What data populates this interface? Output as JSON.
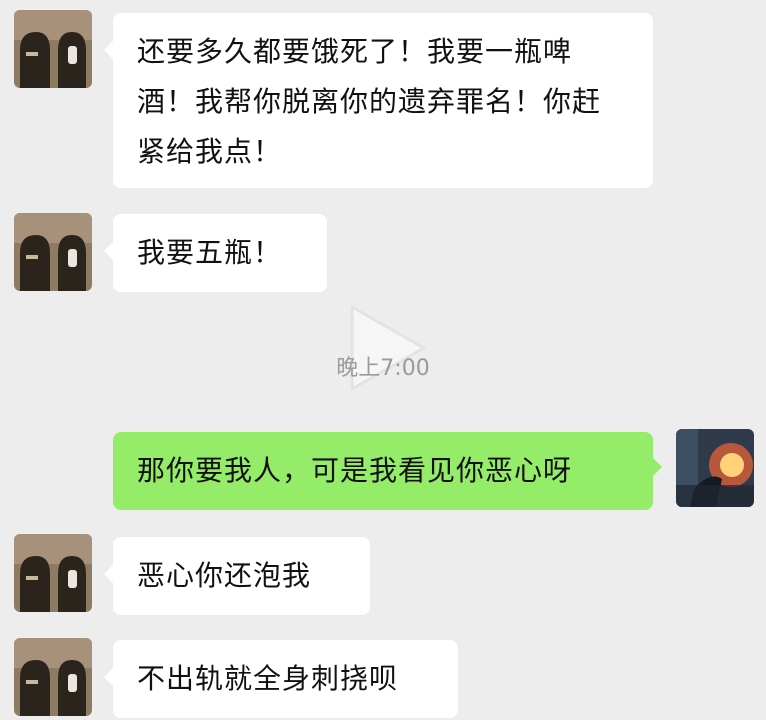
{
  "chat": {
    "messages": [
      {
        "sender": "other",
        "text": "还要多久都要饿死了！我要一瓶啤酒！我帮你脱离你的遗弃罪名！你赶紧给我点！"
      },
      {
        "sender": "other",
        "text": "我要五瓶！"
      },
      {
        "sender": "me",
        "text": "那你要我人，可是我看见你恶心呀"
      },
      {
        "sender": "other",
        "text": "恶心你还泡我"
      },
      {
        "sender": "other",
        "text": "不出轨就全身刺挠呗"
      }
    ],
    "timestamp": "晚上7:00"
  },
  "icons": {
    "video_overlay": "play-icon"
  }
}
